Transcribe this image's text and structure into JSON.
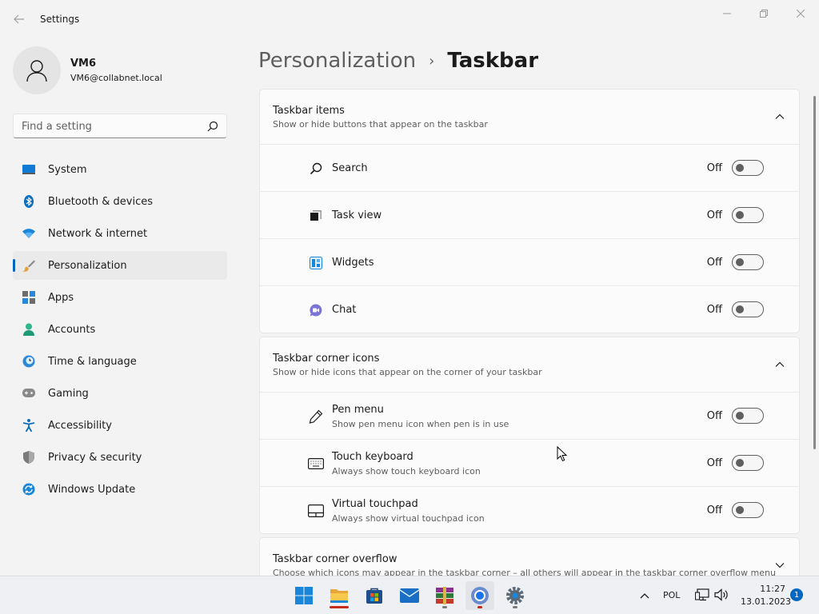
{
  "window": {
    "title": "Settings"
  },
  "user": {
    "name": "VM6",
    "email": "VM6@collabnet.local"
  },
  "search": {
    "placeholder": "Find a setting"
  },
  "nav": {
    "items": [
      {
        "label": "System",
        "icon": "system-icon"
      },
      {
        "label": "Bluetooth & devices",
        "icon": "bluetooth-icon"
      },
      {
        "label": "Network & internet",
        "icon": "wifi-icon"
      },
      {
        "label": "Personalization",
        "icon": "brush-icon",
        "active": true
      },
      {
        "label": "Apps",
        "icon": "apps-icon"
      },
      {
        "label": "Accounts",
        "icon": "accounts-icon"
      },
      {
        "label": "Time & language",
        "icon": "clock-globe-icon"
      },
      {
        "label": "Gaming",
        "icon": "gamepad-icon"
      },
      {
        "label": "Accessibility",
        "icon": "accessibility-icon"
      },
      {
        "label": "Privacy & security",
        "icon": "shield-icon"
      },
      {
        "label": "Windows Update",
        "icon": "update-icon"
      }
    ]
  },
  "header": {
    "parent": "Personalization",
    "separator": "›",
    "current": "Taskbar"
  },
  "sections": [
    {
      "title": "Taskbar items",
      "description": "Show or hide buttons that appear on the taskbar",
      "expanded": true,
      "rows": [
        {
          "label": "Search",
          "state": "Off",
          "icon": "search-icon"
        },
        {
          "label": "Task view",
          "state": "Off",
          "icon": "task-view-icon"
        },
        {
          "label": "Widgets",
          "state": "Off",
          "icon": "widgets-icon"
        },
        {
          "label": "Chat",
          "state": "Off",
          "icon": "chat-icon"
        }
      ]
    },
    {
      "title": "Taskbar corner icons",
      "description": "Show or hide icons that appear on the corner of your taskbar",
      "expanded": true,
      "rows": [
        {
          "label": "Pen menu",
          "sub": "Show pen menu icon when pen is in use",
          "state": "Off",
          "icon": "pen-icon"
        },
        {
          "label": "Touch keyboard",
          "sub": "Always show touch keyboard icon",
          "state": "Off",
          "icon": "keyboard-icon"
        },
        {
          "label": "Virtual touchpad",
          "sub": "Always show virtual touchpad icon",
          "state": "Off",
          "icon": "touchpad-icon"
        }
      ]
    },
    {
      "title": "Taskbar corner overflow",
      "description": "Choose which icons may appear in the taskbar corner – all others will appear in the taskbar corner overflow menu",
      "expanded": false
    }
  ],
  "taskbar": {
    "apps": [
      "start-icon",
      "file-explorer-icon",
      "store-icon",
      "mail-icon",
      "winrar-icon",
      "chrome-icon",
      "settings-icon"
    ],
    "language": "POL",
    "time": "11:27",
    "date": "13.01.2023",
    "notifications": "1"
  },
  "colors": {
    "accent": "#0067c0",
    "background": "#f3f3f3",
    "card": "#fbfbfb"
  }
}
